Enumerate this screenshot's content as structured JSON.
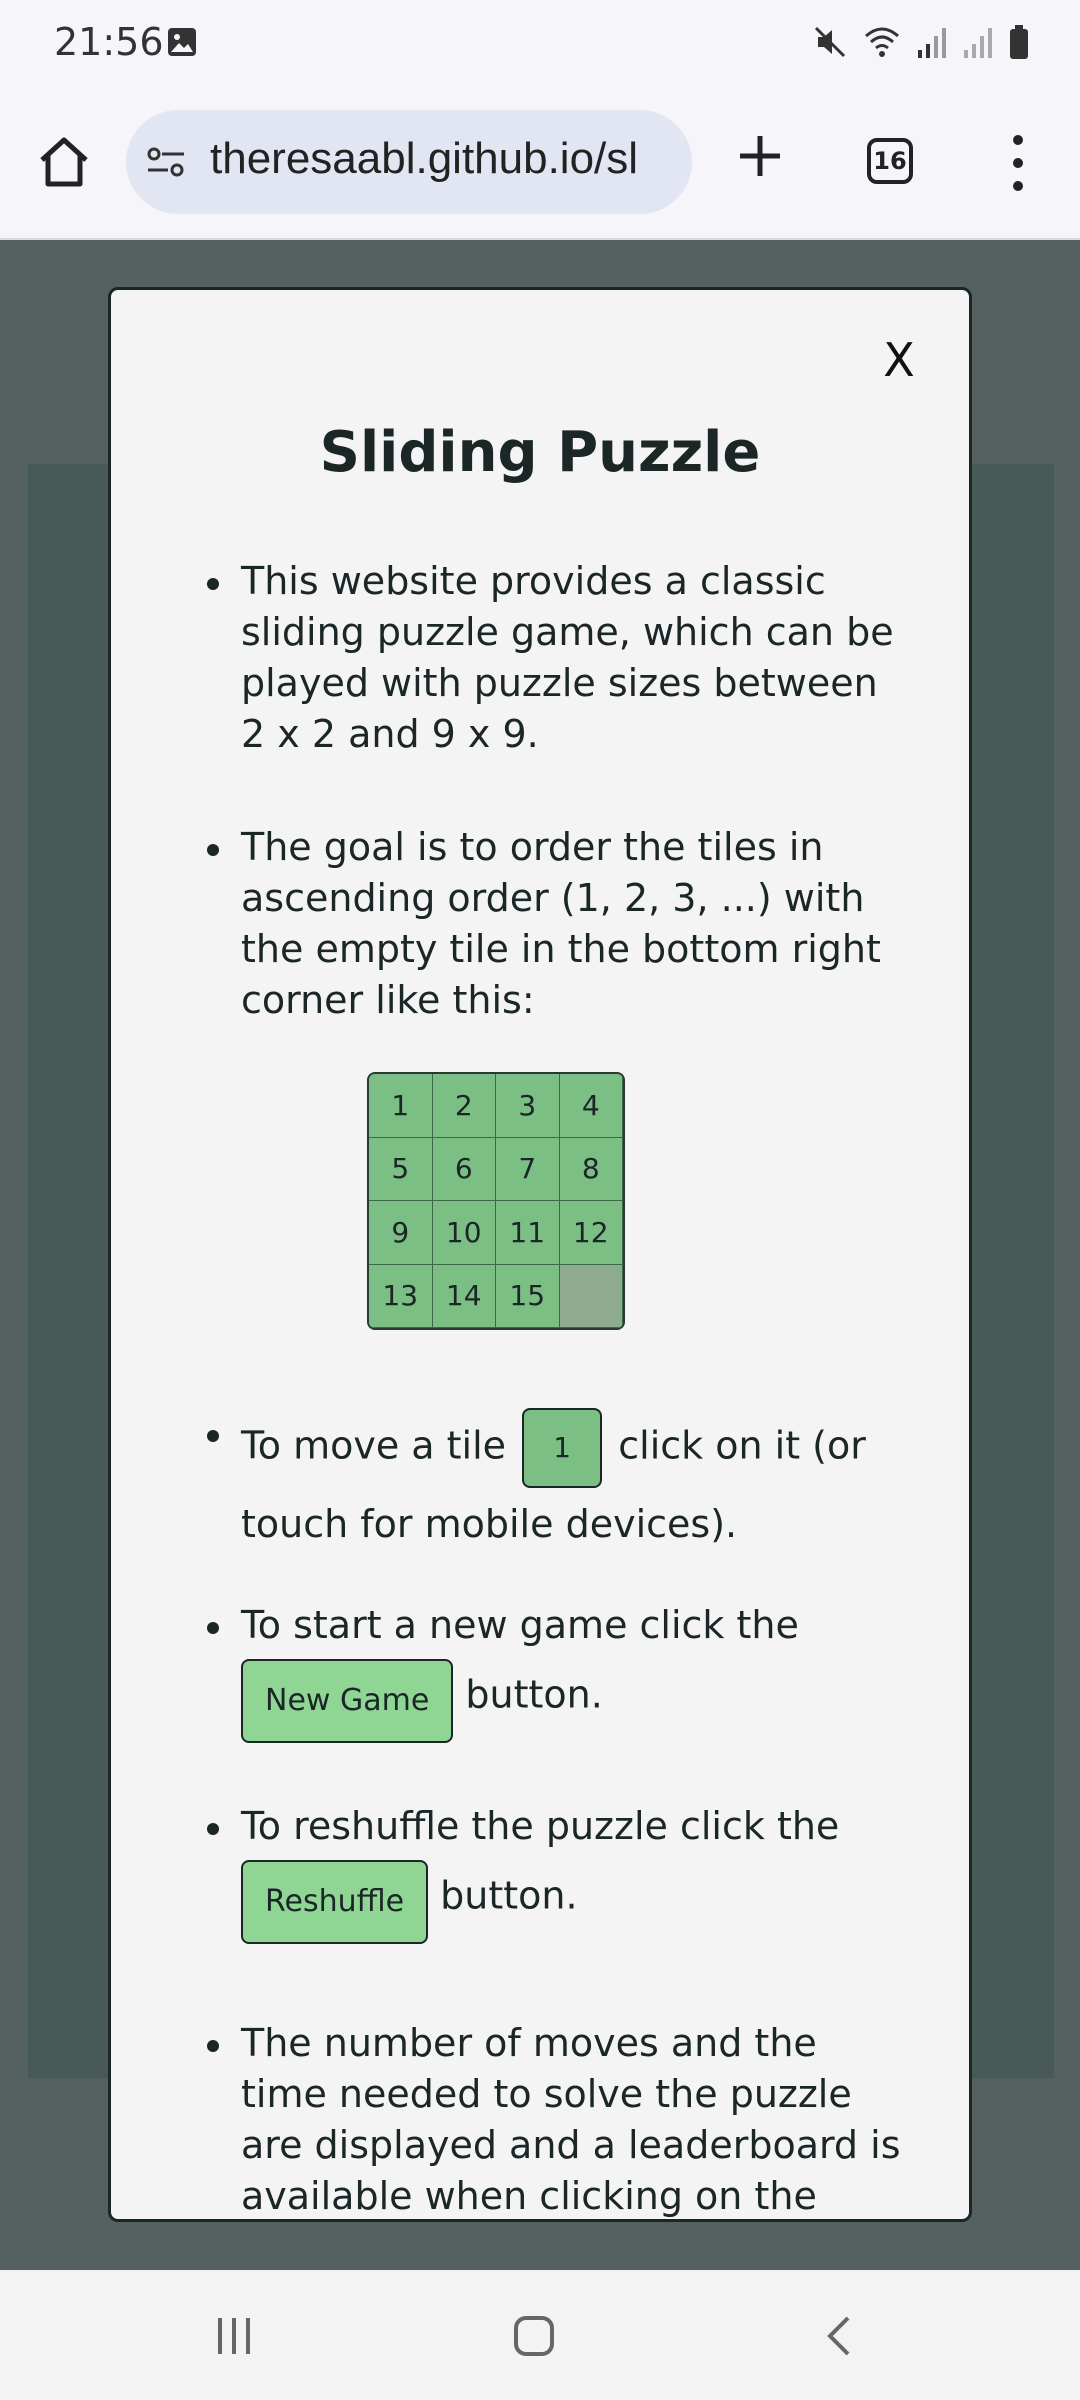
{
  "status_bar": {
    "time": "21:56",
    "icons": [
      "image-icon",
      "mute-icon",
      "wifi-icon",
      "signal-icon",
      "signal-icon-2",
      "battery-icon"
    ]
  },
  "browser": {
    "url": "theresaabl.github.io/sl",
    "tab_count": "16"
  },
  "modal": {
    "close_label": "X",
    "title": "Sliding Puzzle",
    "bullet1": "This website provides a classic sliding puzzle game, which can be played with puzzle sizes between 2 x 2 and 9 x 9.",
    "bullet2": "The goal is to order the tiles in ascending order (1, 2, 3, ...) with the empty tile in the bottom right corner like this:",
    "demo_tiles": [
      "1",
      "2",
      "3",
      "4",
      "5",
      "6",
      "7",
      "8",
      "9",
      "10",
      "11",
      "12",
      "13",
      "14",
      "15",
      ""
    ],
    "bullet3_before": "To move a tile",
    "bullet3_tile": "1",
    "bullet3_after": "click on it (or touch for mobile devices).",
    "bullet4_before": "To start a new game click the",
    "bullet4_button": "New Game",
    "bullet4_after": "button.",
    "bullet5_before": "To reshuffle the puzzle click the",
    "bullet5_button": "Reshuffle",
    "bullet5_after": "button.",
    "bullet6": "The number of moves and the time needed to solve the puzzle are displayed and a leaderboard is available when clicking on the"
  },
  "colors": {
    "tile_green": "#7bbf84",
    "button_green": "#8fd695",
    "modal_bg": "#f4f4f4",
    "overlay": "#556060"
  }
}
